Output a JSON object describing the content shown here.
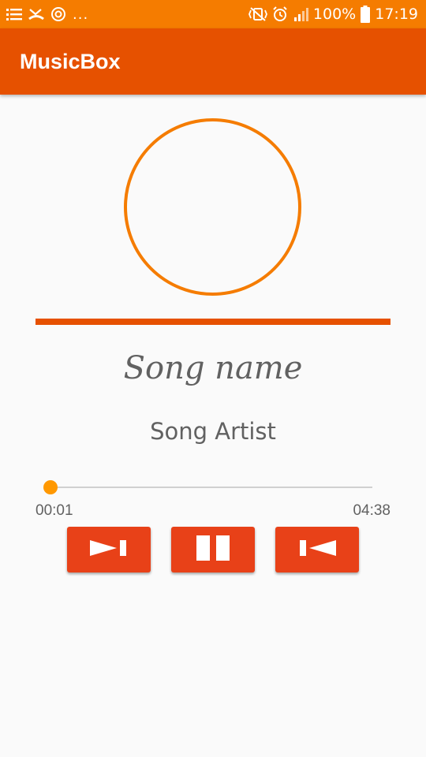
{
  "status_bar": {
    "dots": "...",
    "battery_text": "100%",
    "time": "17:19",
    "left_icons": [
      "list-icon",
      "missed-call-icon",
      "sync-icon"
    ],
    "right_icons": [
      "vibrate-icon",
      "alarm-icon",
      "signal-icon",
      "battery-icon"
    ]
  },
  "app_bar": {
    "title": "MusicBox"
  },
  "player": {
    "song_name": "Song name",
    "song_artist": "Song Artist",
    "progress_fraction": 0.004,
    "time_current": "00:01",
    "time_total": "04:38"
  },
  "controls": {
    "buttons": [
      "play-next-icon",
      "pause-icon",
      "skip-previous-icon"
    ]
  },
  "colors": {
    "status_bar": "#f57c00",
    "app_bar": "#e65100",
    "accent": "#ff9800",
    "button": "#e84118",
    "text_secondary": "#616161"
  }
}
